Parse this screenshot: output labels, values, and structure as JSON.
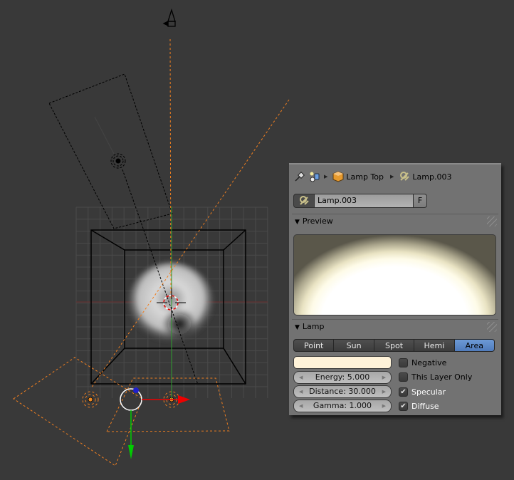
{
  "panel": {
    "breadcrumb": [
      {
        "icon": "pin-icon",
        "label": ""
      },
      {
        "icon": "scene-icon",
        "label": ""
      },
      {
        "icon": "object-cube-icon",
        "label": "Lamp Top"
      },
      {
        "icon": "lamp-data-icon",
        "label": "Lamp.003"
      }
    ],
    "datablock": {
      "name": "Lamp.003",
      "fake_user_label": "F"
    },
    "preview_section": {
      "title": "Preview",
      "expanded": true
    },
    "lamp_section": {
      "title": "Lamp",
      "expanded": true
    },
    "lamp_types": [
      {
        "label": "Point",
        "active": false
      },
      {
        "label": "Sun",
        "active": false
      },
      {
        "label": "Spot",
        "active": false
      },
      {
        "label": "Hemi",
        "active": false
      },
      {
        "label": "Area",
        "active": true
      }
    ],
    "lamp_color": "#fff3d9",
    "fields": {
      "energy": "Energy: 5.000",
      "distance": "Distance: 30.000",
      "gamma": "Gamma: 1.000"
    },
    "checkboxes": [
      {
        "label": "Negative",
        "checked": false
      },
      {
        "label": "This Layer Only",
        "checked": false
      },
      {
        "label": "Specular",
        "checked": true
      },
      {
        "label": "Diffuse",
        "checked": true
      }
    ]
  },
  "viewport": {
    "background": "#393939",
    "selection_color": "#f07f20",
    "axis_x_color": "#e00000",
    "axis_y_color": "#00cc00",
    "axis_z_color": "#2020cc"
  }
}
